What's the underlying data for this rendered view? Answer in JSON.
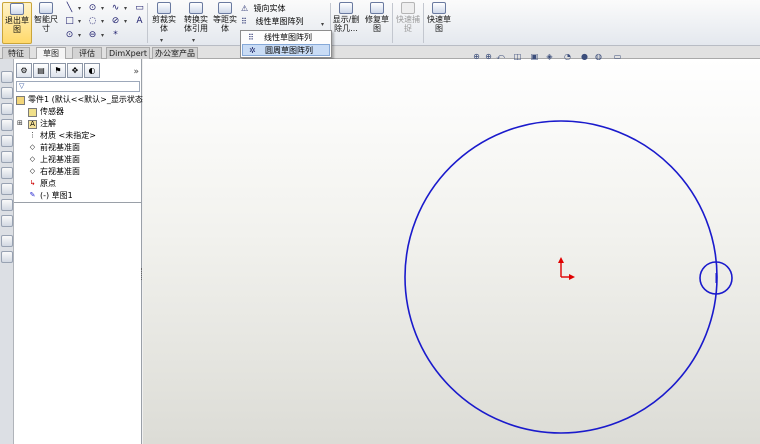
{
  "ribbon": {
    "exit_sketch": "退出草\n图",
    "smart_dimension": "智能尺\n寸",
    "trim_entities": "剪裁实\n体",
    "convert_entities": "转换实\n体引用",
    "offset_entities": "等距实\n体",
    "mirror_entities": "镜向实体",
    "linear_pattern": "线性草图阵列",
    "show_delete_relations": "显示/删\n除几...",
    "repair_sketch": "修复草\n图",
    "rapid_sketch_disabled": "快速捕\n捉",
    "quick_sketch": "快速草\n图"
  },
  "dropdown": {
    "items": [
      "线性草图阵列",
      "圆周草图阵列"
    ]
  },
  "tabs": [
    "特征",
    "草图",
    "评估",
    "DimXpert",
    "办公室产品"
  ],
  "feature_tree": {
    "part_name": "零件1 (默认<<默认>_显示状态",
    "sensors": "传感器",
    "annotations": "注解",
    "material": "材质 <未指定>",
    "front_plane": "前视基准面",
    "top_plane": "上视基准面",
    "right_plane": "右视基准面",
    "origin": "原点",
    "sketch": "(-) 草图1"
  },
  "colors": {
    "sketch_line": "#1a1acc",
    "origin_marker": "#e00000",
    "highlight": "#c9dcf5"
  },
  "icons": [
    "exit-sketch-icon",
    "smart-dimension-icon",
    "line-icon",
    "circle-icon",
    "spline-icon",
    "trim-icon",
    "mirror-icon",
    "linear-pattern-icon",
    "circular-pattern-icon",
    "filter-icon",
    "origin-icon",
    "zoom-icon",
    "view-orientation-icon"
  ]
}
